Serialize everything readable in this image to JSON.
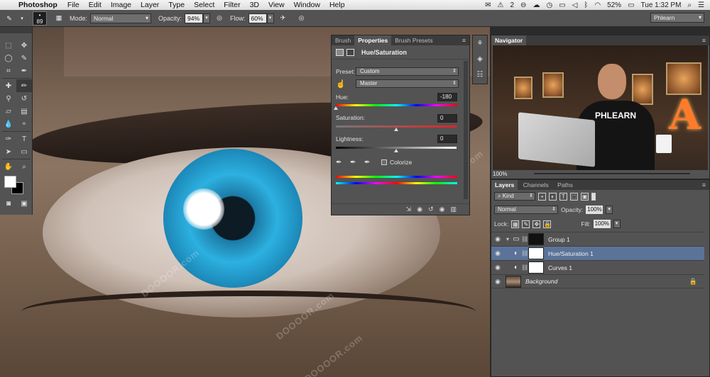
{
  "menubar": {
    "app": "Photoshop",
    "items": [
      "File",
      "Edit",
      "Image",
      "Layer",
      "Type",
      "Select",
      "Filter",
      "3D",
      "View",
      "Window",
      "Help"
    ],
    "status": {
      "badge_count": "2",
      "battery": "52%",
      "clock": "Tue 1:32 PM"
    }
  },
  "options_bar": {
    "brush_size": "89",
    "mode_label": "Mode:",
    "mode_value": "Normal",
    "opacity_label": "Opacity:",
    "opacity_value": "94%",
    "flow_label": "Flow:",
    "flow_value": "60%",
    "workspace": "Phlearn"
  },
  "properties_panel": {
    "tabs": [
      "Brush",
      "Properties",
      "Brush Presets"
    ],
    "active_tab": "Properties",
    "title": "Hue/Saturation",
    "preset_label": "Preset:",
    "preset_value": "Custom",
    "channel_value": "Master",
    "hue_label": "Hue:",
    "hue_value": "-180",
    "hue_position": 0.0,
    "saturation_label": "Saturation:",
    "saturation_value": "0",
    "saturation_position": 0.5,
    "lightness_label": "Lightness:",
    "lightness_value": "0",
    "lightness_position": 0.5,
    "colorize_label": "Colorize",
    "colorize_checked": false
  },
  "navigator": {
    "title": "Navigator",
    "zoom": "100%",
    "shirt_text": "PHLEARN",
    "sign_letter": "A"
  },
  "layers_panel": {
    "tabs": [
      "Layers",
      "Channels",
      "Paths"
    ],
    "active_tab": "Layers",
    "filter_value": "Kind",
    "blend_mode": "Normal",
    "opacity_label": "Opacity:",
    "opacity_value": "100%",
    "lock_label": "Lock:",
    "fill_label": "Fill:",
    "fill_value": "100%",
    "layers": [
      {
        "name": "Group 1",
        "type": "group",
        "selected": false
      },
      {
        "name": "Hue/Saturation 1",
        "type": "hue-saturation",
        "selected": true
      },
      {
        "name": "Curves 1",
        "type": "curves",
        "selected": false
      },
      {
        "name": "Background",
        "type": "background",
        "selected": false
      }
    ]
  },
  "canvas": {
    "watermark": "DOOOOR.com"
  },
  "colors": {
    "panel_bg": "#535353",
    "selected_layer": "#5c7399",
    "iris": "#2cb1e0"
  }
}
